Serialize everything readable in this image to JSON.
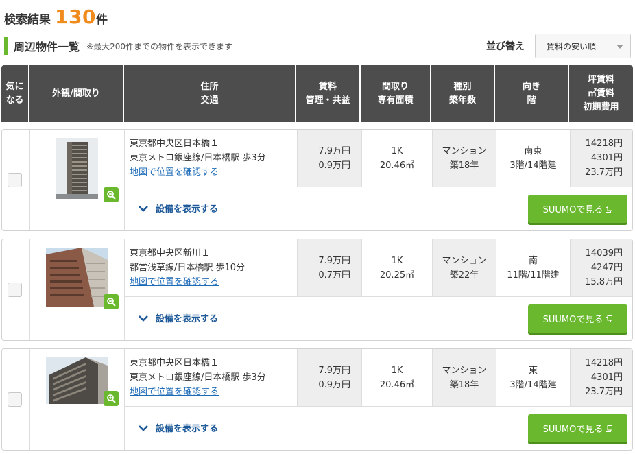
{
  "result": {
    "label": "検索結果",
    "count": "130",
    "unit": "件"
  },
  "list": {
    "title": "周辺物件一覧",
    "note": "※最大200件までの物件を表示できます"
  },
  "sort": {
    "label": "並び替え",
    "selected": "賃料の安い順"
  },
  "columns": {
    "fav": [
      "気に",
      "なる"
    ],
    "photo": "外観/間取り",
    "address": [
      "住所",
      "交通"
    ],
    "rent": [
      "賃料",
      "管理・共益"
    ],
    "layout": [
      "間取り",
      "専有面積"
    ],
    "type": [
      "種別",
      "築年数"
    ],
    "direction": [
      "向き",
      "階"
    ],
    "tsubo": [
      "坪賃料",
      "㎡賃料",
      "初期費用"
    ]
  },
  "common": {
    "map_link": "地図で位置を確認する",
    "facility": "設備を表示する",
    "suumo_button": "SUUMOで見る"
  },
  "listings": [
    {
      "address": "東京都中央区日本橋１",
      "access": "東京メトロ銀座線/日本橋駅 歩3分",
      "rent": "7.9万円",
      "fee": "0.9万円",
      "layout": "1K",
      "area": "20.46㎡",
      "type": "マンション",
      "age": "築18年",
      "direction": "南東",
      "floor": "3階/14階建",
      "tsubo": "14218円",
      "sqm": "4301円",
      "initial": "23.7万円"
    },
    {
      "address": "東京都中央区新川１",
      "access": "都営浅草線/日本橋駅 歩10分",
      "rent": "7.9万円",
      "fee": "0.7万円",
      "layout": "1K",
      "area": "20.25㎡",
      "type": "マンション",
      "age": "築22年",
      "direction": "南",
      "floor": "11階/11階建",
      "tsubo": "14039円",
      "sqm": "4247円",
      "initial": "15.8万円"
    },
    {
      "address": "東京都中央区日本橋１",
      "access": "東京メトロ銀座線/日本橋駅 歩3分",
      "rent": "7.9万円",
      "fee": "0.9万円",
      "layout": "1K",
      "area": "20.46㎡",
      "type": "マンション",
      "age": "築18年",
      "direction": "東",
      "floor": "3階/14階建",
      "tsubo": "14218円",
      "sqm": "4301円",
      "initial": "23.7万円"
    }
  ],
  "colors": {
    "accent_orange": "#f08c1e",
    "accent_green": "#6ab82e",
    "header_dark": "#4d4d4d",
    "link_blue": "#1e6bb8"
  },
  "icons": [
    "zoom-icon",
    "chevron-down-icon",
    "external-link-icon",
    "building-photo"
  ]
}
